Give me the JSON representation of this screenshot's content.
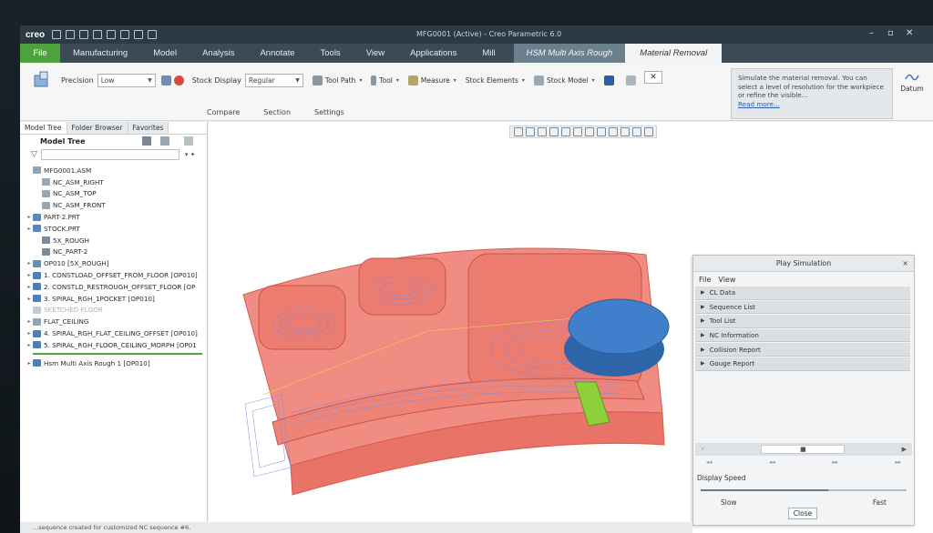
{
  "app": {
    "logo": "creo",
    "window_title": "MFG0001 (Active) - Creo Parametric 6.0",
    "window_controls": [
      "–",
      "▫",
      "✕"
    ]
  },
  "tabs": [
    {
      "label": "File"
    },
    {
      "label": "Manufacturing"
    },
    {
      "label": "Model"
    },
    {
      "label": "Analysis"
    },
    {
      "label": "Annotate"
    },
    {
      "label": "Tools"
    },
    {
      "label": "View"
    },
    {
      "label": "Applications"
    },
    {
      "label": "Mill"
    },
    {
      "label": "HSM Multi Axis Rough"
    },
    {
      "label": "Material Removal"
    }
  ],
  "ribbon": {
    "precision_label": "Precision",
    "precision_value": "Low",
    "stock_display_label": "Stock Display",
    "stock_display_value": "Regular",
    "tool_path": "Tool Path",
    "tool": "Tool",
    "measure": "Measure",
    "stock_elements": "Stock Elements",
    "stock_model": "Stock Model",
    "sub_tabs": [
      "Compare",
      "Section",
      "Settings"
    ],
    "close_x": "✕",
    "tooltip_text": "Simulate the material removal. You can select a level of resolution for the workpiece or refine the visible...",
    "tooltip_link": "Read more...",
    "datum": "Datum"
  },
  "model_tree": {
    "tabs": [
      "Model Tree",
      "Folder Browser",
      "Favorites"
    ],
    "title": "Model Tree",
    "items": [
      {
        "label": "MFG0001.ASM",
        "indent": 0,
        "expander": "",
        "icon_color": "#8fa4b6"
      },
      {
        "label": "NC_ASM_RIGHT",
        "indent": 1,
        "expander": "",
        "icon_color": "#9aa7b0"
      },
      {
        "label": "NC_ASM_TOP",
        "indent": 1,
        "expander": "",
        "icon_color": "#9aa7b0"
      },
      {
        "label": "NC_ASM_FRONT",
        "indent": 1,
        "expander": "",
        "icon_color": "#9aa7b0"
      },
      {
        "label": "PART-2.PRT",
        "indent": 0,
        "expander": "▸",
        "icon_color": "#5f86b8"
      },
      {
        "label": "STOCK.PRT",
        "indent": 0,
        "expander": "▸",
        "icon_color": "#5f86b8"
      },
      {
        "label": "5X_ROUGH",
        "indent": 1,
        "expander": "",
        "icon_color": "#7c8a95"
      },
      {
        "label": "NC_PART-2",
        "indent": 1,
        "expander": "",
        "icon_color": "#7c8a95"
      },
      {
        "label": "OP010 [5X_ROUGH]",
        "indent": 0,
        "expander": "▸",
        "icon_color": "#6a8fa8"
      },
      {
        "label": "1. CONSTLOAD_OFFSET_FROM_FLOOR [OP010]",
        "indent": 0,
        "expander": "▸",
        "icon_color": "#4e7fb6"
      },
      {
        "label": "2. CONSTLD_RESTROUGH_OFFSET_FLOOR [OP",
        "indent": 0,
        "expander": "▸",
        "icon_color": "#4e7fb6"
      },
      {
        "label": "3. SPIRAL_RGH_1POCKET [OP010]",
        "indent": 0,
        "expander": "▸",
        "icon_color": "#4e7fb6"
      },
      {
        "label": "SKETCHED FLOOR",
        "indent": 0,
        "expander": "",
        "icon_color": "#c5ccd1",
        "dim": true
      },
      {
        "label": "FLAT_CEILING",
        "indent": 0,
        "expander": "▸",
        "icon_color": "#8fa4b6"
      },
      {
        "label": "4. SPIRAL_RGH_FLAT_CEILING_OFFSET [OP010]",
        "indent": 0,
        "expander": "▸",
        "icon_color": "#4e7fb6"
      },
      {
        "label": "5. SPIRAL_RGH_FLOOR_CEILING_MORPH [OP01",
        "indent": 0,
        "expander": "▸",
        "icon_color": "#4e7fb6"
      }
    ],
    "after_sep": {
      "label": "Hsm Multi Axis Rough 1 [OP010]",
      "expander": "▸",
      "icon_color": "#4e7fb6"
    }
  },
  "simulation": {
    "title": "Play Simulation",
    "close_x": "×",
    "menu": [
      "File",
      "View"
    ],
    "sections": [
      "CL Data",
      "Sequence List",
      "Tool List",
      "NC Information",
      "Collision Report",
      "Gouge Report"
    ],
    "controls_left": "◦",
    "stop": "■",
    "controls_right": "▶",
    "step_row": [
      "◂◂",
      "◂◂",
      "▸▸",
      "▸▸"
    ],
    "speed_label": "Display Speed",
    "speed_fraction": 0.62,
    "slow": "Slow",
    "fast": "Fast",
    "close_button": "Close"
  },
  "status_text": "...sequence created for customized NC sequence #6.",
  "colors": {
    "file_tab": "#4da23c",
    "stock": "#f08c82",
    "stock_dark": "#d65c4f",
    "tool_head": "#3f7fcc",
    "tool_shank": "#8ed03a",
    "toolpath": "#7f8ce0"
  }
}
